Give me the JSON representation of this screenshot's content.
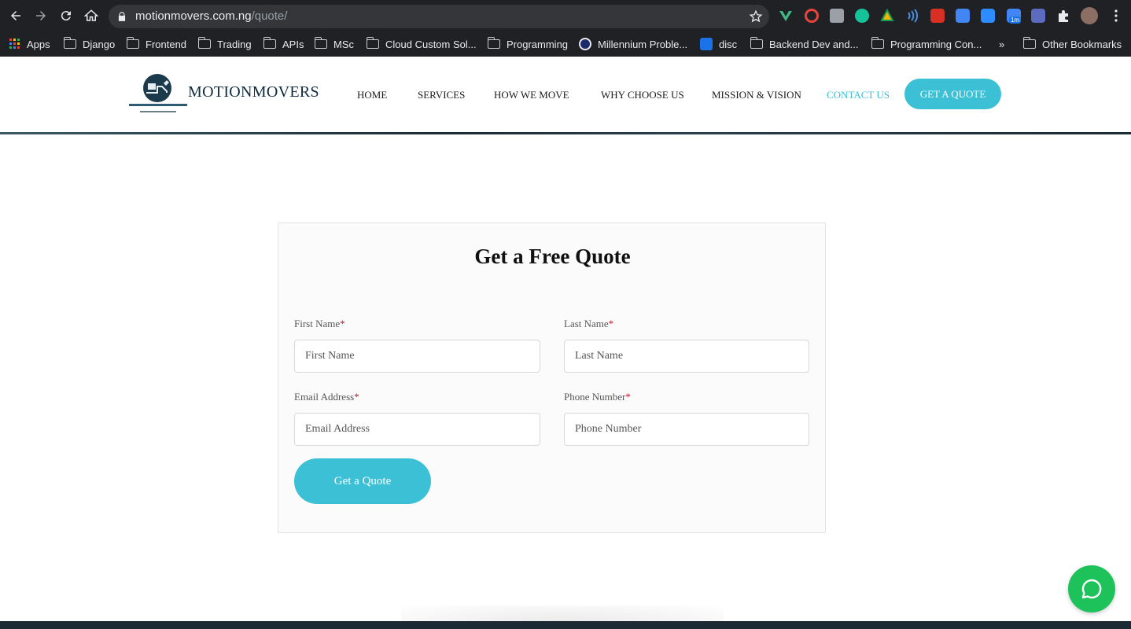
{
  "browser": {
    "url_host": "motionmovers.com.ng",
    "url_path": "/quote/",
    "bookmarks": [
      {
        "label": "Apps",
        "icon": "apps-grid-icon"
      },
      {
        "label": "Django",
        "icon": "folder-icon"
      },
      {
        "label": "Frontend",
        "icon": "folder-icon"
      },
      {
        "label": "Trading",
        "icon": "folder-icon"
      },
      {
        "label": "APIs",
        "icon": "folder-icon"
      },
      {
        "label": "MSc",
        "icon": "folder-icon"
      },
      {
        "label": "Cloud Custom Sol...",
        "icon": "folder-icon"
      },
      {
        "label": "Programming",
        "icon": "folder-icon"
      },
      {
        "label": "Millennium Proble...",
        "icon": "site-icon"
      },
      {
        "label": "disc",
        "icon": "flag-icon"
      },
      {
        "label": "Backend Dev and...",
        "icon": "folder-icon"
      },
      {
        "label": "Programming Con...",
        "icon": "folder-icon"
      },
      {
        "label": "»",
        "icon": "overflow-icon"
      },
      {
        "label": "Other Bookmarks",
        "icon": "folder-icon"
      }
    ],
    "extension_badge": "1m"
  },
  "header": {
    "brand": "MOTIONMOVERS",
    "nav": [
      {
        "label": "HOME"
      },
      {
        "label": "SERVICES"
      },
      {
        "label": "HOW WE MOVE"
      },
      {
        "label": "WHY CHOOSE US"
      },
      {
        "label": "MISSION & VISION"
      },
      {
        "label": "CONTACT US",
        "active": true
      }
    ],
    "cta_label": "GET A QUOTE",
    "accent_color": "#3cc0d6"
  },
  "form": {
    "title": "Get a Free Quote",
    "required_mark": "*",
    "fields": {
      "first_name": {
        "label": "First Name",
        "placeholder": "First Name"
      },
      "last_name": {
        "label": "Last Name",
        "placeholder": "Last Name"
      },
      "email": {
        "label": "Email Address",
        "placeholder": "Email Address"
      },
      "phone": {
        "label": "Phone Number",
        "placeholder": "Phone Number"
      }
    },
    "submit_label": "Get a Quote"
  }
}
